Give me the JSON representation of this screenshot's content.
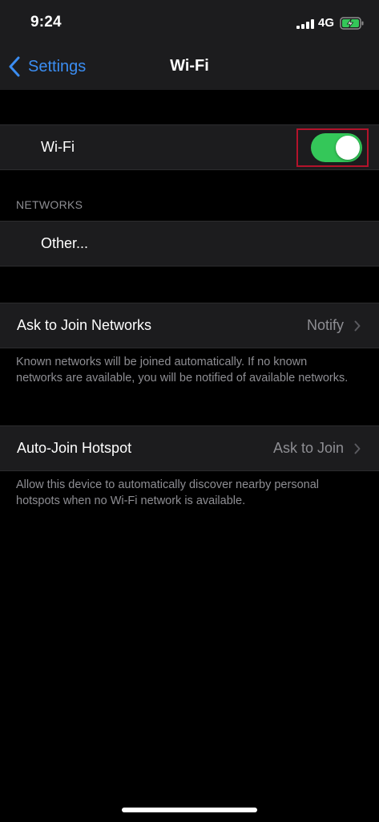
{
  "status_bar": {
    "time": "9:24",
    "network": "4G",
    "icons": [
      "signal-icon",
      "battery-charging-icon"
    ]
  },
  "nav": {
    "back_label": "Settings",
    "title": "Wi-Fi",
    "back_icon": "chevron-left-icon"
  },
  "wifi_row": {
    "label": "Wi-Fi",
    "toggle_on": true
  },
  "networks": {
    "header": "NETWORKS",
    "other_label": "Other..."
  },
  "ask_to_join": {
    "label": "Ask to Join Networks",
    "value": "Notify",
    "footnote": "Known networks will be joined automatically. If no known networks are available, you will be notified of available networks."
  },
  "auto_join": {
    "label": "Auto-Join Hotspot",
    "value": "Ask to Join",
    "footnote": "Allow this device to automatically discover nearby personal hotspots when no Wi-Fi network is available."
  },
  "colors": {
    "background": "#000000",
    "cell": "#1c1c1e",
    "accent": "#3b8df2",
    "toggle_on": "#34c759",
    "secondary_text": "#8e8e93",
    "highlight": "#b3132b"
  }
}
